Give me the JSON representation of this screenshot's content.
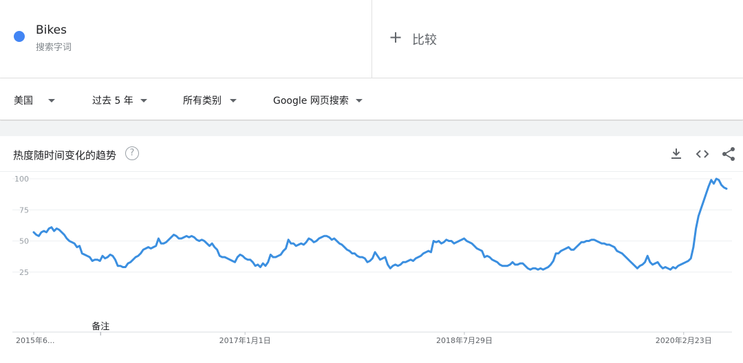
{
  "term": {
    "name": "Bikes",
    "type": "搜索字词",
    "color": "#4285f4"
  },
  "compare": {
    "label": "比较",
    "icon": "plus-icon"
  },
  "filters": [
    {
      "label": "美国"
    },
    {
      "label": "过去 5 年"
    },
    {
      "label": "所有类别"
    },
    {
      "label": "Google 网页搜索"
    }
  ],
  "card": {
    "title": "热度随时间变化的趋势",
    "help_icon": "help-circle-icon",
    "actions": [
      "download-icon",
      "embed-code-icon",
      "share-icon"
    ]
  },
  "chart_data": {
    "type": "line",
    "title": "",
    "xlabel": "",
    "ylabel": "",
    "ylim": [
      0,
      100
    ],
    "yticks": [
      25,
      50,
      75,
      100
    ],
    "grid": true,
    "line_color": "#3b8fe0",
    "x_labels": [
      {
        "label": "2015年6...",
        "date": "2015-06-28"
      },
      {
        "label": "2017年1月1日",
        "date": "2017-01-01"
      },
      {
        "label": "2018年7月29日",
        "date": "2018-07-29"
      },
      {
        "label": "2020年2月23日",
        "date": "2020-02-23"
      }
    ],
    "annotation": {
      "label": "备注",
      "date": "2015-12-20"
    },
    "series": [
      {
        "x_start": "2015-06-28",
        "x_end": "2020-06-14",
        "values": [
          57,
          55,
          54,
          57,
          58,
          57,
          60,
          61,
          58,
          60,
          59,
          57,
          55,
          52,
          50,
          49,
          48,
          45,
          46,
          40,
          39,
          38,
          37,
          34,
          35,
          35,
          34,
          38,
          36,
          37,
          39,
          38,
          35,
          30,
          30,
          29,
          29,
          32,
          33,
          35,
          37,
          38,
          40,
          43,
          44,
          45,
          44,
          45,
          46,
          52,
          48,
          48,
          49,
          51,
          53,
          55,
          54,
          52,
          52,
          53,
          54,
          53,
          54,
          53,
          51,
          50,
          51,
          50,
          48,
          46,
          48,
          45,
          43,
          38,
          37,
          37,
          36,
          35,
          34,
          33,
          37,
          39,
          38,
          36,
          35,
          35,
          33,
          30,
          31,
          29,
          32,
          30,
          33,
          39,
          37,
          37,
          38,
          39,
          42,
          44,
          51,
          48,
          48,
          46,
          47,
          48,
          47,
          49,
          52,
          51,
          49,
          50,
          52,
          53,
          54,
          54,
          53,
          51,
          52,
          50,
          48,
          47,
          45,
          43,
          42,
          40,
          40,
          38,
          37,
          37,
          36,
          33,
          34,
          36,
          41,
          38,
          35,
          36,
          37,
          31,
          28,
          30,
          31,
          30,
          31,
          33,
          33,
          34,
          35,
          34,
          36,
          37,
          38,
          40,
          41,
          42,
          41,
          50,
          49,
          50,
          48,
          49,
          51,
          50,
          50,
          48,
          49,
          50,
          51,
          52,
          50,
          49,
          48,
          46,
          44,
          43,
          42,
          37,
          38,
          37,
          35,
          34,
          33,
          31,
          30,
          30,
          30,
          31,
          33,
          31,
          31,
          32,
          32,
          30,
          28,
          27,
          28,
          28,
          27,
          28,
          27,
          28,
          29,
          31,
          34,
          40,
          40,
          42,
          43,
          44,
          45,
          43,
          43,
          45,
          47,
          49,
          49,
          50,
          50,
          51,
          51,
          50,
          49,
          48,
          48,
          47,
          47,
          46,
          45,
          42,
          41,
          40,
          38,
          36,
          34,
          32,
          30,
          28,
          30,
          31,
          33,
          38,
          33,
          31,
          32,
          33,
          30,
          28,
          29,
          28,
          27,
          29,
          28,
          30,
          31,
          32,
          33,
          34,
          36,
          45,
          60,
          70,
          76,
          82,
          88,
          94,
          99,
          96,
          100,
          99,
          95,
          93,
          92
        ]
      }
    ]
  }
}
